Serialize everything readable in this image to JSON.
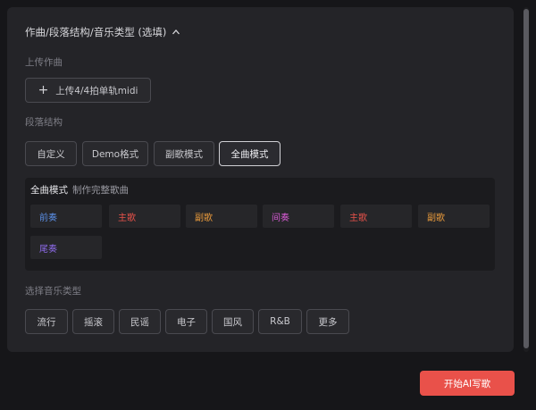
{
  "header": {
    "title": "作曲/段落结构/音乐类型 (选填)"
  },
  "upload": {
    "label": "上传作曲",
    "button_label": "上传4/4拍单轨midi"
  },
  "structure": {
    "label": "段落结构",
    "options": [
      "自定义",
      "Demo格式",
      "副歌模式",
      "全曲模式"
    ],
    "selected": "全曲模式"
  },
  "mode": {
    "title": "全曲模式",
    "subtitle": "制作完整歌曲",
    "sections": [
      {
        "name": "前奏",
        "color": "#5b8fe6"
      },
      {
        "name": "主歌",
        "color": "#e8524a"
      },
      {
        "name": "副歌",
        "color": "#e89a3c"
      },
      {
        "name": "间奏",
        "color": "#d35ad0"
      },
      {
        "name": "主歌",
        "color": "#e8524a"
      },
      {
        "name": "副歌",
        "color": "#e89a3c"
      },
      {
        "name": "尾奏",
        "color": "#8c6ae6"
      }
    ]
  },
  "genre": {
    "label": "选择音乐类型",
    "options": [
      "流行",
      "摇滚",
      "民谣",
      "电子",
      "国风",
      "R&B",
      "更多"
    ]
  },
  "cta": {
    "label": "开始AI写歌",
    "color": "#e9514a"
  }
}
